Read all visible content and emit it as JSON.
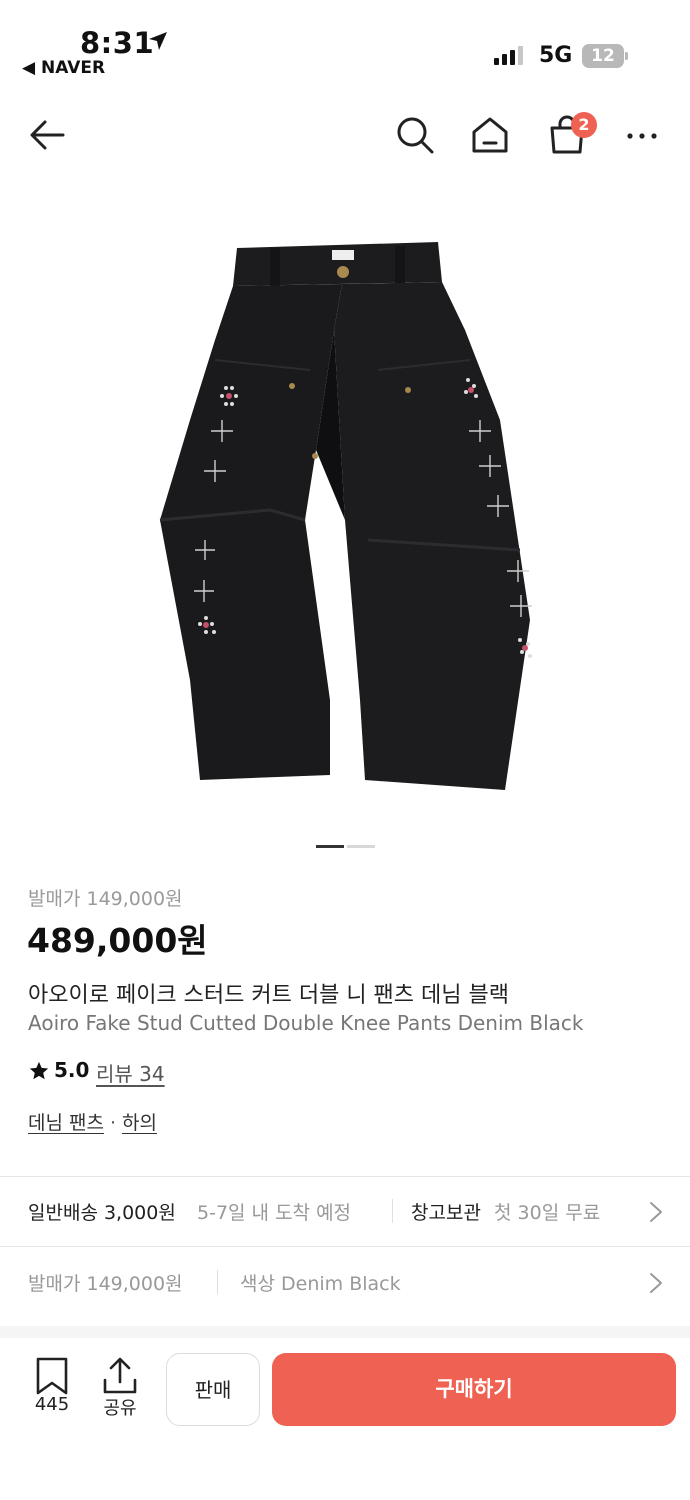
{
  "status_bar": {
    "time": "8:31",
    "back_app": "◀ NAVER",
    "network": "5G",
    "battery": "12"
  },
  "nav": {
    "cart_count": "2",
    "icons": [
      "back-arrow-icon",
      "search-icon",
      "home-icon",
      "cart-icon",
      "more-icon"
    ]
  },
  "gallery": {
    "current_page": 1,
    "total_pages": 2
  },
  "product": {
    "original_price": "발매가 149,000원",
    "price": "489,000원",
    "title_ko": "아오이로 페이크 스터드 커트 더블 니 팬츠 데님 블랙",
    "title_en": "Aoiro Fake Stud Cutted Double Knee Pants Denim Black",
    "rating": "5.0",
    "reviews": "리뷰 34",
    "category": "데님 팬츠",
    "category_separator": "·",
    "parent_category": "하의"
  },
  "shipping": {
    "main": "일반배송 3,000원",
    "sub": "5-7일 내 도착 예정",
    "storage_main": "창고보관",
    "storage_sub": "첫 30일 무료"
  },
  "options": {
    "original_price": "발매가 149,000원",
    "color": "색상 Denim Black"
  },
  "bottom_bar": {
    "wish_count": "445",
    "share_label": "공유",
    "sell_label": "판매",
    "buy_label": "구매하기"
  },
  "colors": {
    "accent": "#ef6253",
    "text": "#222222",
    "muted": "#999999"
  }
}
